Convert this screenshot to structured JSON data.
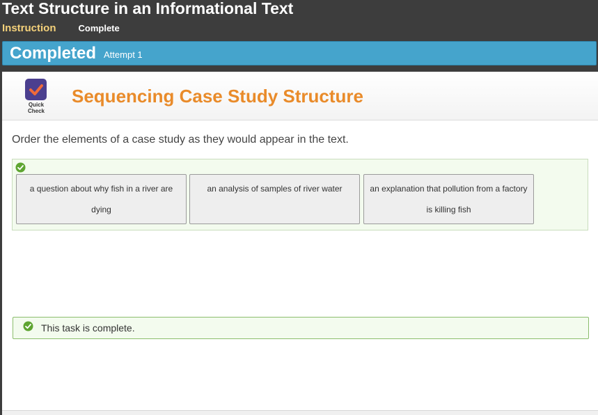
{
  "header": {
    "title": "Text Structure in an Informational Text",
    "tabs": [
      "Instruction",
      "Complete"
    ]
  },
  "status": {
    "title": "Completed",
    "attempt": "Attempt 1",
    "color": "#45a4cc"
  },
  "activity": {
    "badge_lines": [
      "Quick",
      "Check"
    ],
    "title": "Sequencing Case Study Structure",
    "title_color": "#e98b2a",
    "instructions": "Order the elements of a case study as they would appear in the text.",
    "cards": [
      "a question about why fish in a river are dying",
      "an analysis of samples of river water",
      "an explanation that pollution from a factory is killing fish"
    ],
    "complete_message": "This task is complete.",
    "check_color": "#5ea531"
  }
}
